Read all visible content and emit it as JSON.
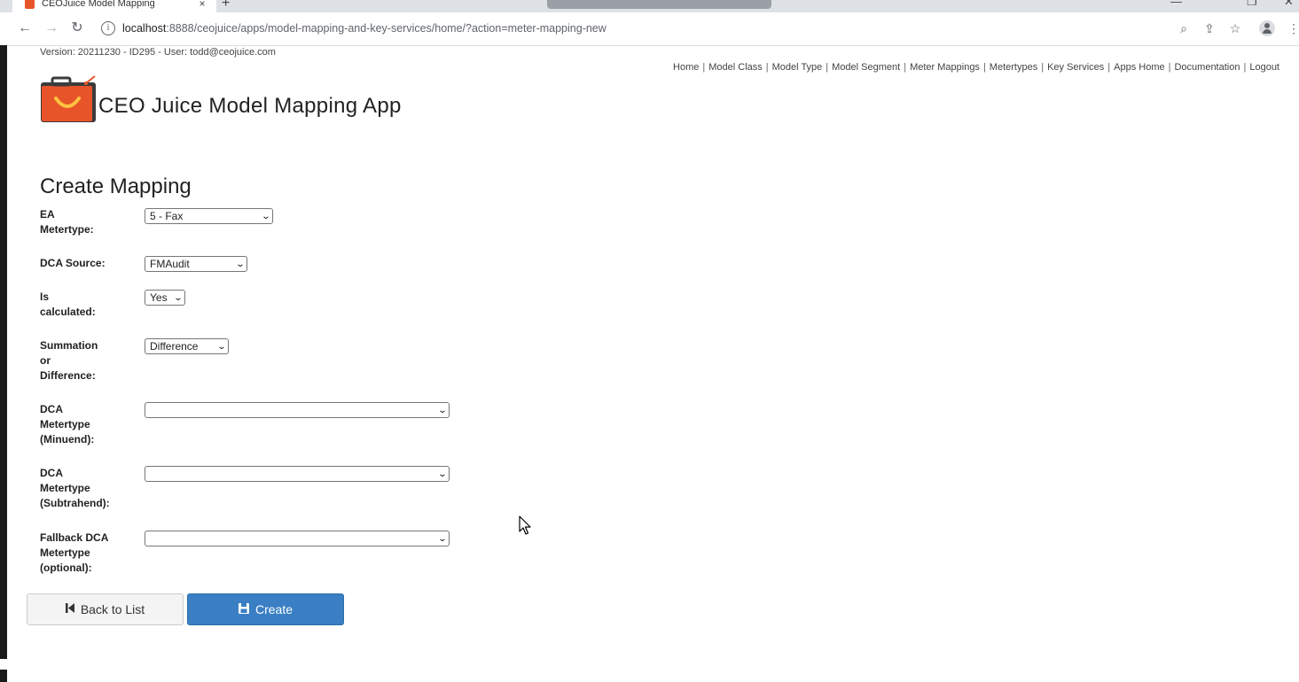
{
  "browser": {
    "tab_title": "CEOJuice Model Mapping",
    "tab_close": "×",
    "new_tab": "+",
    "url_host": "localhost",
    "url_path": ":8888/ceojuice/apps/model-mapping-and-key-services/home/?action=meter-mapping-new"
  },
  "header": {
    "version_line": "Version: 20211230 - ID295 - User: todd@ceojuice.com",
    "nav": [
      "Home",
      "Model Class",
      "Model Type",
      "Model Segment",
      "Meter Mappings",
      "Metertypes",
      "Key Services",
      "Apps Home",
      "Documentation",
      "Logout"
    ],
    "nav_sep": "|",
    "app_title": "CEO Juice Model Mapping App"
  },
  "form": {
    "heading": "Create Mapping",
    "fields": [
      {
        "label_lines": [
          "EA",
          "Metertype:"
        ],
        "value": "5 - Fax"
      },
      {
        "label_lines": [
          "DCA Source:"
        ],
        "value": "FMAudit"
      },
      {
        "label_lines": [
          "Is",
          "calculated:"
        ],
        "value": "Yes"
      },
      {
        "label_lines": [
          "Summation",
          "or",
          "Difference:"
        ],
        "value": "Difference"
      },
      {
        "label_lines": [
          "DCA",
          "Metertype",
          "(Minuend):"
        ],
        "value": ""
      },
      {
        "label_lines": [
          "DCA",
          "Metertype",
          "(Subtrahend):"
        ],
        "value": ""
      },
      {
        "label_lines": [
          "Fallback DCA",
          "Metertype",
          "(optional):"
        ],
        "value": ""
      }
    ],
    "back_label": "Back to List",
    "create_label": "Create"
  },
  "colors": {
    "primary_button": "#3a7fc4",
    "logo_orange": "#e8542a",
    "logo_dark": "#3b3b3b"
  },
  "icons": {
    "back": "step-backward-icon",
    "create": "floppy-disk-icon"
  }
}
